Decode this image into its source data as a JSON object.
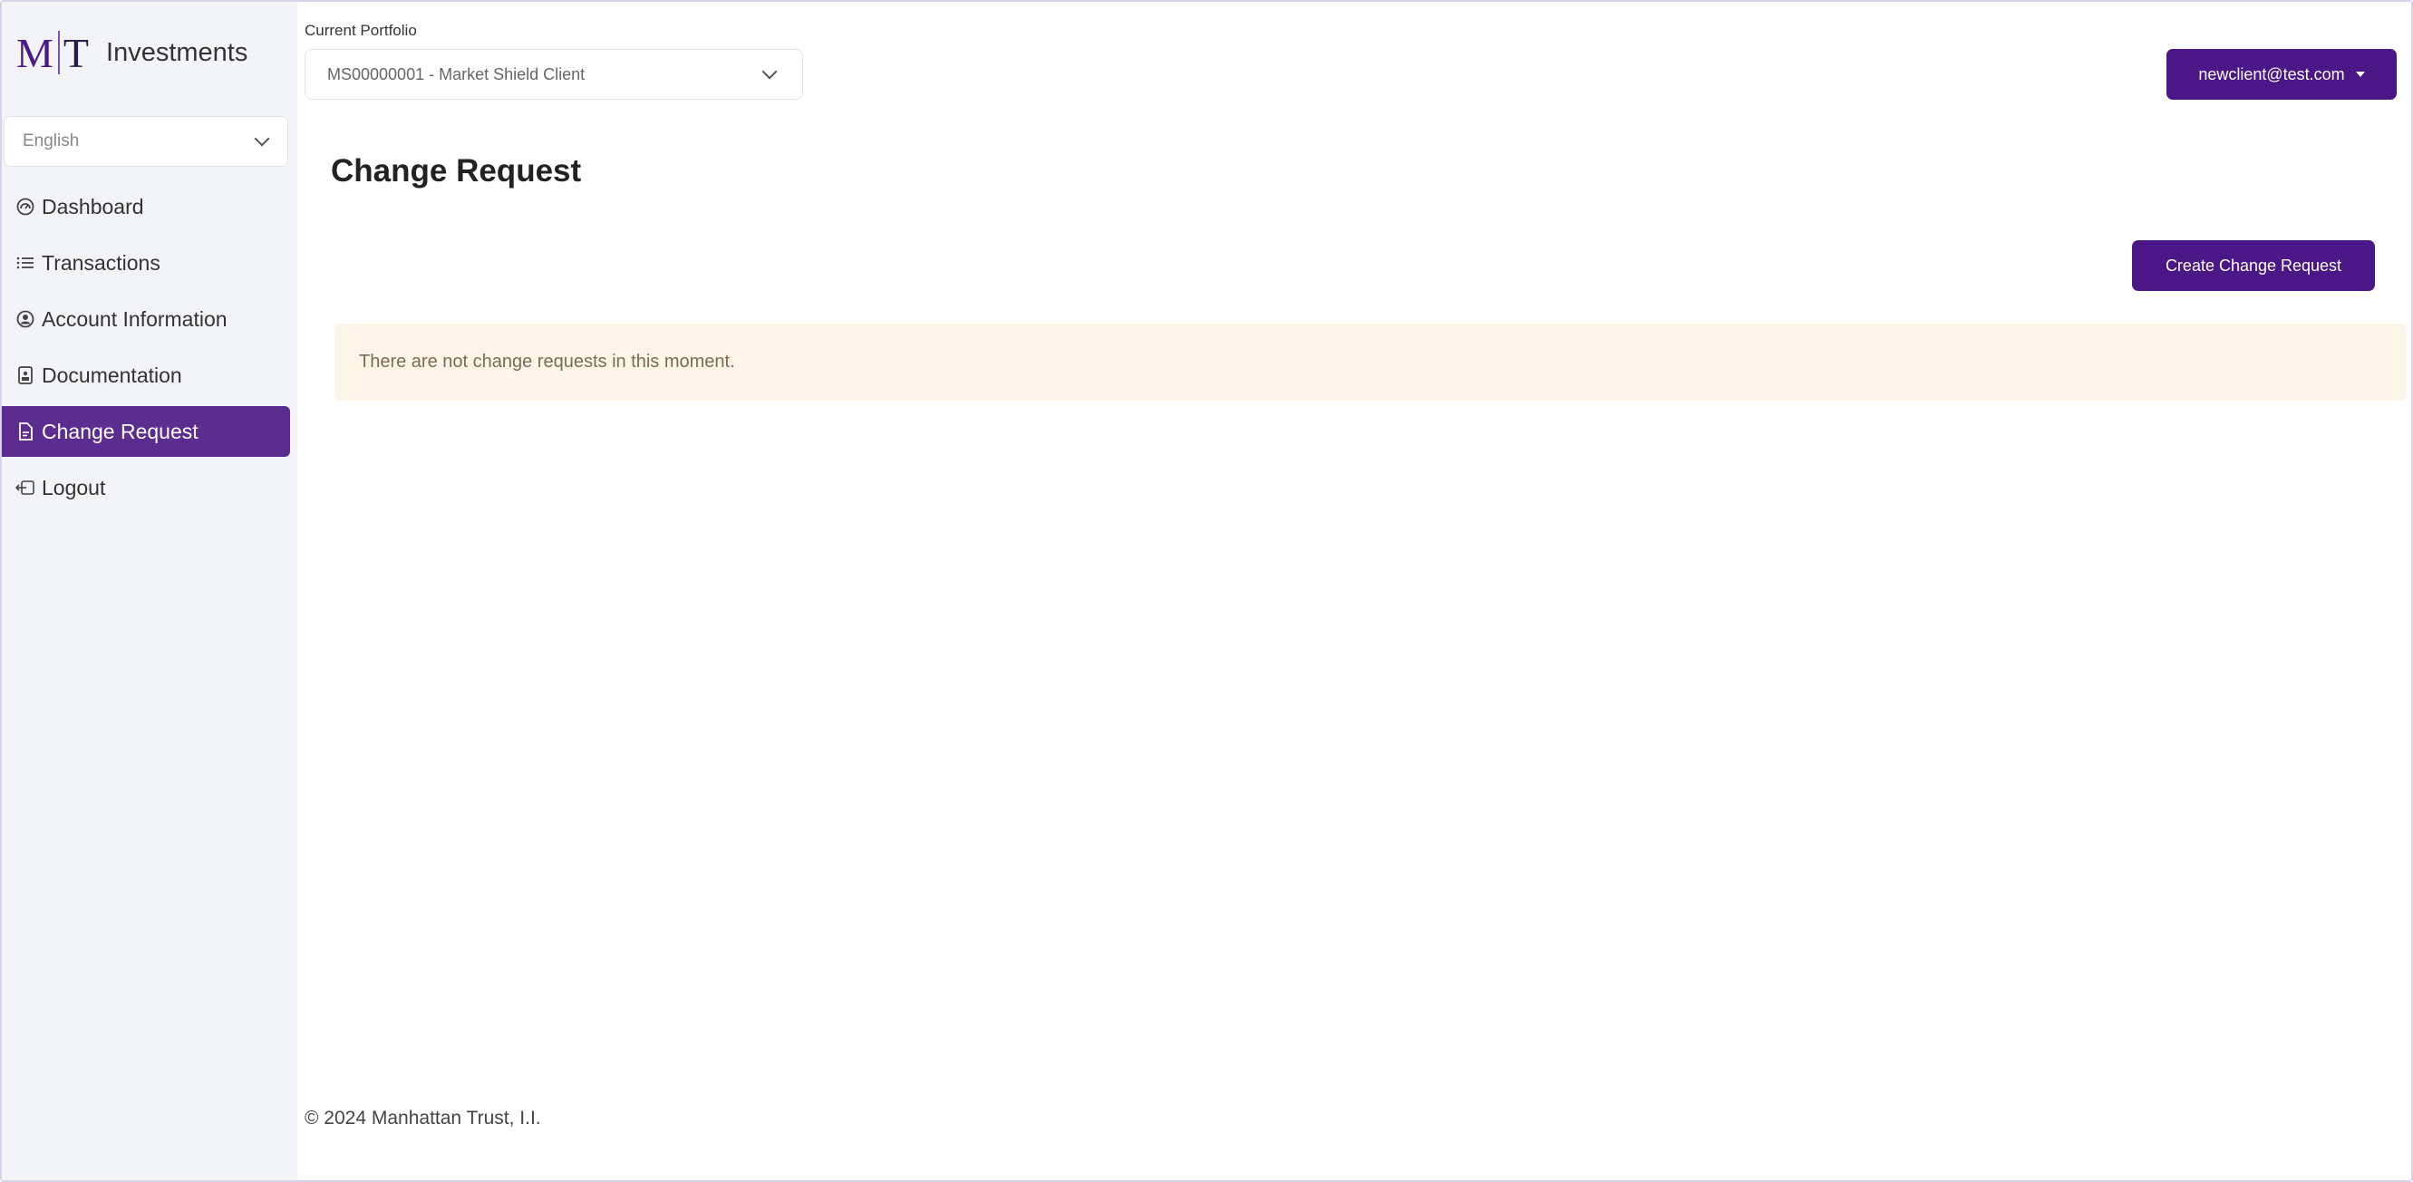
{
  "brand": {
    "mark_m": "M",
    "mark_t": "T",
    "name": "Investments"
  },
  "language": {
    "selected": "English"
  },
  "sidebar": {
    "items": [
      {
        "label": "Dashboard",
        "icon": "dashboard-icon"
      },
      {
        "label": "Transactions",
        "icon": "list-icon"
      },
      {
        "label": "Account Information",
        "icon": "user-circle-icon"
      },
      {
        "label": "Documentation",
        "icon": "document-icon"
      },
      {
        "label": "Change Request",
        "icon": "file-edit-icon",
        "active": true
      },
      {
        "label": "Logout",
        "icon": "logout-icon"
      }
    ]
  },
  "header": {
    "portfolio_label": "Current Portfolio",
    "portfolio_value": "MS00000001 - Market Shield Client",
    "user_email": "newclient@test.com"
  },
  "main": {
    "title": "Change Request",
    "create_button": "Create Change Request",
    "empty_message": "There are not change requests in this moment."
  },
  "footer": {
    "text": "© 2024 Manhattan Trust, I.I."
  },
  "colors": {
    "accent": "#4b1685",
    "active_nav": "#5b2d8f",
    "alert_bg": "#fdf5e8",
    "sidebar_bg": "#f3f4f7"
  }
}
